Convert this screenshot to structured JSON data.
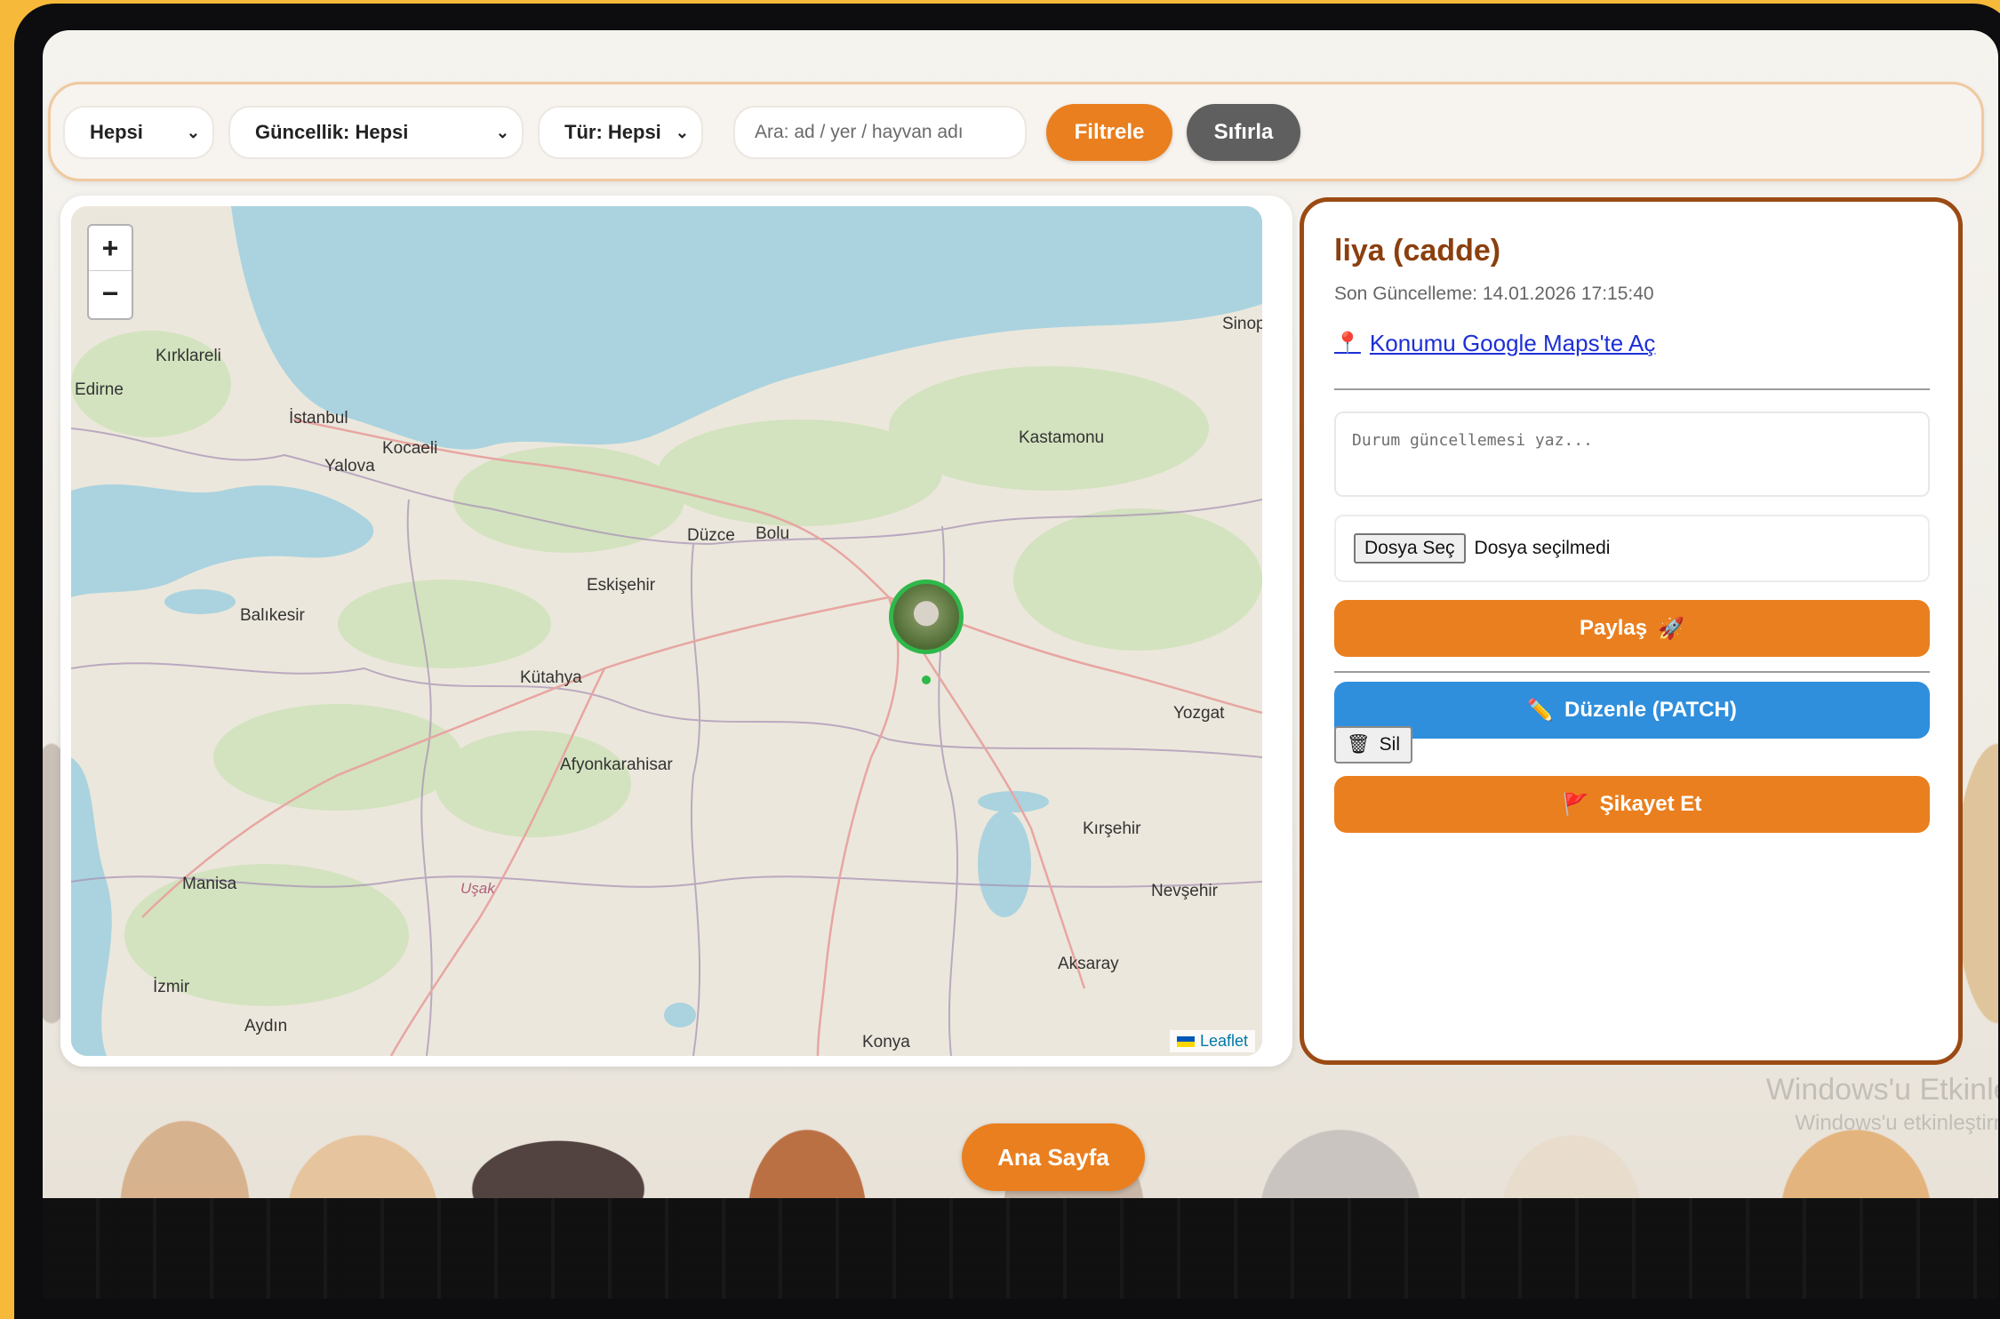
{
  "filters": {
    "status_select": "Hepsi",
    "recency_select": "Güncellik: Hepsi",
    "type_select": "Tür: Hepsi",
    "search_placeholder": "Ara: ad / yer / hayvan adı",
    "filter_button": "Filtrele",
    "reset_button": "Sıfırla",
    "colors": {
      "filter": "#ea7f1f",
      "reset": "#5f5f5f"
    }
  },
  "map": {
    "zoom_in": "+",
    "zoom_out": "−",
    "attribution": "Leaflet",
    "cities": [
      {
        "name": "İstanbul"
      },
      {
        "name": "Kocaeli"
      },
      {
        "name": "Yalova"
      },
      {
        "name": "Eskişehir"
      },
      {
        "name": "Balıkesir"
      },
      {
        "name": "Kütahya"
      },
      {
        "name": "Afyonkarahisar"
      },
      {
        "name": "Manisa"
      },
      {
        "name": "İzmir"
      },
      {
        "name": "Aydın"
      },
      {
        "name": "Uşak"
      },
      {
        "name": "Konya"
      },
      {
        "name": "Aksaray"
      },
      {
        "name": "Nevşehir"
      },
      {
        "name": "Kırşehir"
      },
      {
        "name": "Yozgat"
      },
      {
        "name": "Kastamonu"
      },
      {
        "name": "Bolu"
      },
      {
        "name": "Düzce"
      },
      {
        "name": "Edirne"
      },
      {
        "name": "Kırklareli"
      },
      {
        "name": "Sinop"
      }
    ],
    "marker_icon": "animal-photo-marker"
  },
  "detail": {
    "title": "liya (cadde)",
    "updated": "Son Güncelleme: 14.01.2026 17:15:40",
    "maps_link": "Konumu Google Maps'te Aç",
    "status_placeholder": "Durum güncellemesi yaz...",
    "file_button": "Dosya Seç",
    "file_status": "Dosya seçilmedi",
    "share_button": "Paylaş",
    "edit_button": "Düzenle (PATCH)",
    "delete_button": "Sil",
    "report_button": "Şikayet Et",
    "colors": {
      "share": "#ea7f1f",
      "edit": "#2f8fdc",
      "report": "#ea7f1f",
      "title": "#8b3f0e"
    }
  },
  "footer": {
    "home_button": "Ana Sayfa"
  },
  "watermark": {
    "line1": "Windows'u Etkinleşt",
    "line2": "Windows'u etkinleştirmek"
  }
}
